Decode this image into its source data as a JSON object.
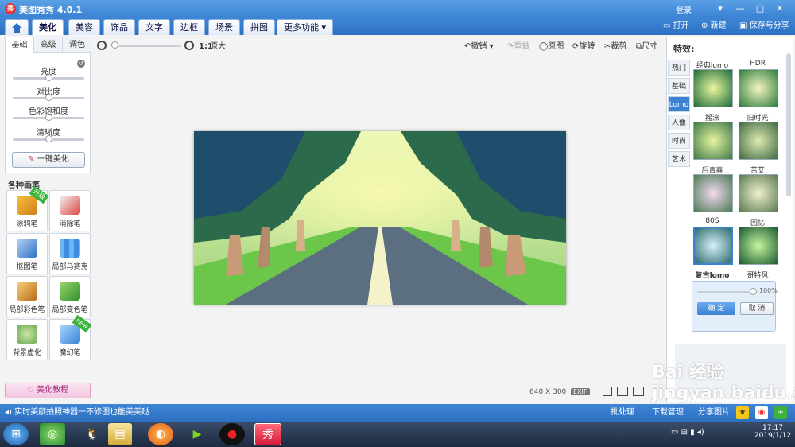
{
  "window": {
    "title": "美图秀秀 4.0.1",
    "logo": "秀",
    "login": "登录",
    "controls": [
      "▾",
      "—",
      "□",
      "✕"
    ]
  },
  "menu": {
    "tabs": [
      "美化",
      "美容",
      "饰品",
      "文字",
      "边框",
      "场景",
      "拼图",
      "更多功能 ▾"
    ],
    "open": "打开",
    "new": "新建",
    "save": "保存与分享"
  },
  "left": {
    "subtabs": [
      "基础",
      "高级",
      "调色"
    ],
    "sliders": [
      {
        "label": "亮度",
        "value": 0.5
      },
      {
        "label": "对比度",
        "value": 0.5
      },
      {
        "label": "色彩饱和度",
        "value": 0.5
      },
      {
        "label": "清晰度",
        "value": 0.5
      }
    ],
    "one_key": "一键美化",
    "brush_title": "各种画笔",
    "tools": [
      {
        "label": "涂鸦笔",
        "badge": "升级"
      },
      {
        "label": "消除笔",
        "badge": ""
      },
      {
        "label": "抠图笔",
        "badge": ""
      },
      {
        "label": "局部马赛克",
        "badge": ""
      },
      {
        "label": "局部彩色笔",
        "badge": ""
      },
      {
        "label": "局部变色笔",
        "badge": ""
      },
      {
        "label": "背景虚化",
        "badge": ""
      },
      {
        "label": "魔幻笔",
        "badge": "new"
      }
    ],
    "tutorial": "美化教程"
  },
  "toolbar": {
    "ratio": "1:1",
    "original": "原大",
    "undo": "撤销",
    "redo": "重做",
    "orig_img": "原图",
    "rotate": "旋转",
    "crop": "裁剪",
    "size": "尺寸"
  },
  "image_info": {
    "width": "640",
    "x": "X",
    "height": "300",
    "exif": "EXIF"
  },
  "right": {
    "title": "特效:",
    "tabs": [
      "热门",
      "基础",
      "Lomo",
      "人像",
      "时尚",
      "艺术"
    ],
    "effects": [
      "经典lomo",
      "HDR",
      "摇滚",
      "旧时光",
      "后青春",
      "苦艾",
      "80S",
      "回忆",
      "复古lomo",
      "哥特风"
    ],
    "strength": "100%",
    "confirm": "确 定",
    "cancel": "取 消"
  },
  "status": {
    "tip": "实时美颜拍照神器一不修图也能美美哒",
    "batch": "批处理",
    "download": "下载管理",
    "share": "分享图片"
  },
  "taskbar": {
    "time": "17:17",
    "date": "2019/1/12"
  },
  "watermark": "Bai 经验 jingyan.baidu.com",
  "colors": {
    "accent": "#3b82d4",
    "title": "#4a90dc"
  }
}
